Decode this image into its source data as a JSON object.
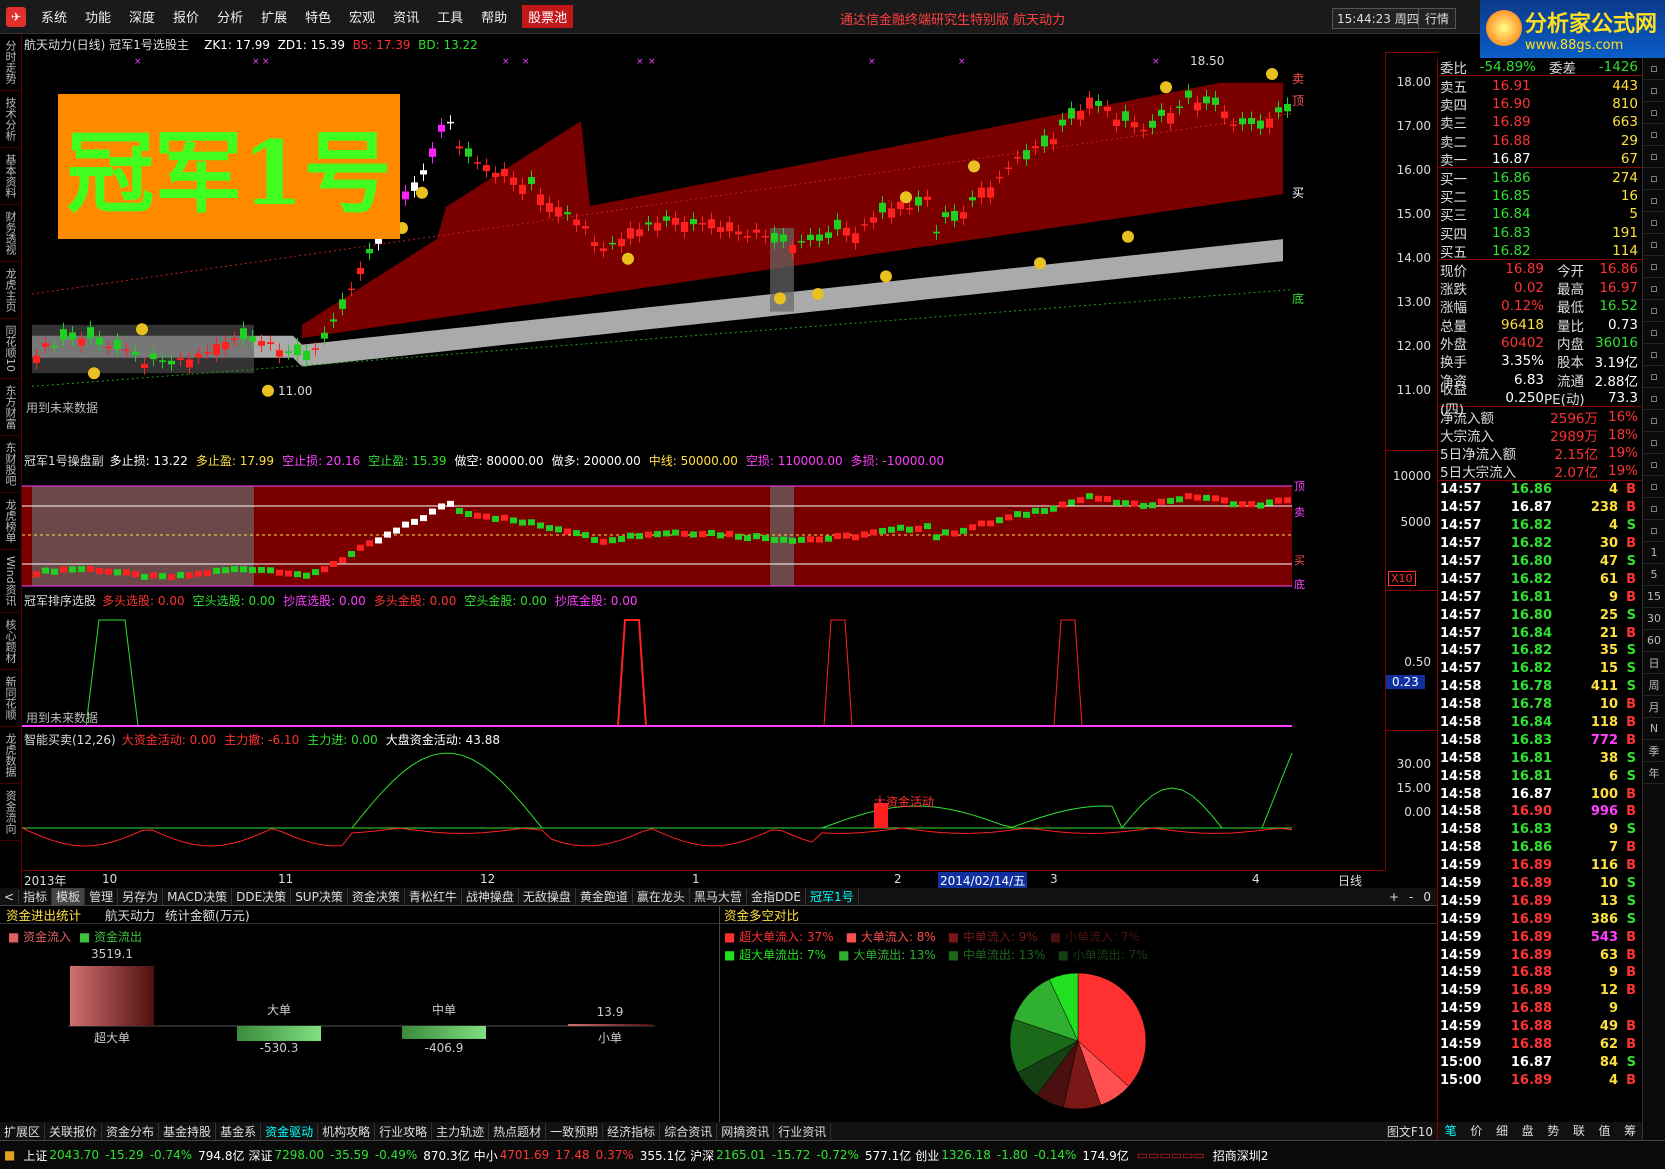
{
  "menu": {
    "items": [
      "系统",
      "功能",
      "深度",
      "报价",
      "分析",
      "扩展",
      "特色",
      "宏观",
      "资讯",
      "工具",
      "帮助"
    ],
    "stock_pool": "股票池",
    "window_title": "通达信金融终端研究生特别版  航天动力",
    "clock": "15:44:23",
    "clock_suffix": "周四",
    "hq_button": "行情",
    "brand_line1": "分析家公式网",
    "brand_line2": "www.88gs.com"
  },
  "left_tabs": [
    "分时走势",
    "技术分析",
    "基本资料",
    "财务透视",
    "龙虎主页",
    "同花顺10",
    "东方财富"
  ],
  "left_tabs_lower": [
    "东财股吧",
    "龙虎榜单",
    "Wind资讯",
    "核心题材",
    "新同花顺",
    "龙虎数据",
    "资金流向"
  ],
  "main_chart": {
    "title": "航天动力(日线) 冠军1号选股主",
    "zk1": "ZK1: 17.99",
    "zd1": "ZD1: 15.39",
    "bs": "BS: 17.39",
    "bd": "BD: 13.22",
    "banner": "冠军1号",
    "high_label": "18.50",
    "low_label": "11.00",
    "future_note": "用到未来数据",
    "side_labels": [
      "卖",
      "顶",
      "买",
      "底"
    ],
    "y_ticks": [
      "18.00",
      "17.00",
      "16.00",
      "15.00",
      "14.00",
      "13.00",
      "12.00",
      "11.00"
    ],
    "colors": {
      "band": "#7a0000",
      "grey_band": "#c8c8c8"
    }
  },
  "panel2": {
    "title": "冠军1号操盘副",
    "items": [
      {
        "label": "多止损: 13.22",
        "color": "#ffffff"
      },
      {
        "label": "多止盈: 17.99",
        "color": "#ffe040"
      },
      {
        "label": "空止损: 20.16",
        "color": "#ff40ff"
      },
      {
        "label": "空止盈: 15.39",
        "color": "#30e030"
      },
      {
        "label": "做空: 80000.00",
        "color": "#ffffff"
      },
      {
        "label": "做多: 20000.00",
        "color": "#ffffff"
      },
      {
        "label": "中线: 50000.00",
        "color": "#ffe040"
      },
      {
        "label": "空损: 110000.00",
        "color": "#ff40ff"
      },
      {
        "label": "多损: -10000.00",
        "color": "#ff40ff"
      }
    ],
    "y_ticks": [
      "10000",
      "5000"
    ],
    "x10": "X10",
    "side_labels": [
      "顶",
      "卖",
      "买",
      "底"
    ]
  },
  "panel3": {
    "title": "冠军排序选股",
    "items": [
      {
        "label": "多头选股: 0.00",
        "color": "#ff3333"
      },
      {
        "label": "空头选股: 0.00",
        "color": "#30e030"
      },
      {
        "label": "抄底选股: 0.00",
        "color": "#ff40ff"
      },
      {
        "label": "多头金股: 0.00",
        "color": "#ff3333"
      },
      {
        "label": "空头金股: 0.00",
        "color": "#30e030"
      },
      {
        "label": "抄底金股: 0.00",
        "color": "#ff40ff"
      }
    ],
    "y_tick": "0.50",
    "value_box": "0.23",
    "future_note": "用到未来数据"
  },
  "panel4": {
    "title": "智能买卖(12,26)",
    "items": [
      {
        "label": "大资金活动: 0.00",
        "color": "#ff3333"
      },
      {
        "label": "主力撤: -6.10",
        "color": "#ff3333"
      },
      {
        "label": "主力进: 0.00",
        "color": "#30e030"
      },
      {
        "label": "大盘资金活动: 43.88",
        "color": "#ffffff"
      }
    ],
    "annotation": "大资金活动",
    "y_ticks": [
      "30.00",
      "15.00",
      "0.00"
    ]
  },
  "xaxis": {
    "labels": [
      "2013年",
      "10",
      "11",
      "12",
      "1",
      "2",
      "2014/02/14/五",
      "3",
      "4"
    ],
    "period": "日线"
  },
  "tabs_row1": [
    "指标",
    "模板",
    "管理",
    "另存为",
    "MACD决策",
    "DDE决策",
    "SUP决策",
    "资金决策",
    "青松红牛",
    "战神操盘",
    "无敌操盘",
    "黄金跑道",
    "赢在龙头",
    "黑马大营",
    "金指DDE",
    "冠军1号"
  ],
  "tabs_row1_right": [
    "+",
    "-",
    "0"
  ],
  "capital": {
    "title": "资金进出统计",
    "stock": "航天动力",
    "unit": "统计金额(万元)",
    "legend_in": "资金流入",
    "legend_out": "资金流出",
    "bars": [
      {
        "name": "超大单",
        "value": "3519.1"
      },
      {
        "name": "大单",
        "value": "-530.3"
      },
      {
        "name": "中单",
        "value": "-406.9"
      },
      {
        "name": "小单",
        "value": "13.9"
      }
    ]
  },
  "compare": {
    "title": "资金多空对比",
    "row_in": [
      {
        "label": "超大单流入: 37%",
        "color": "#ff3030"
      },
      {
        "label": "大单流入:  8%",
        "color": "#ff5050"
      },
      {
        "label": "中单流入:  9%",
        "color": "#7a1818"
      },
      {
        "label": "小单流入:  7%",
        "color": "#4a1010"
      }
    ],
    "row_out": [
      {
        "label": "超大单流出:  7%",
        "color": "#20e020"
      },
      {
        "label": "大单流出: 13%",
        "color": "#30b030"
      },
      {
        "label": "中单流出: 13%",
        "color": "#1a6a1a"
      },
      {
        "label": "小单流出:  7%",
        "color": "#144014"
      }
    ],
    "pie": [
      37,
      8,
      9,
      7,
      7,
      13,
      13,
      7
    ]
  },
  "tabs_row2": [
    "扩展区",
    "关联报价",
    "资金分布",
    "基金持股",
    "基金系",
    "资金驱动",
    "机构攻略",
    "行业攻略",
    "主力轨迹",
    "热点题材",
    "一致预期",
    "经济指标",
    "综合资讯",
    "网摘资讯",
    "行业资讯"
  ],
  "tabs_row2_right": "图文F10",
  "quote": {
    "weibi_label": "委比",
    "weibi": "-54.89%",
    "weicha_label": "委差",
    "weicha": "-1426",
    "sell": [
      {
        "label": "卖五",
        "price": "16.91",
        "vol": "443"
      },
      {
        "label": "卖四",
        "price": "16.90",
        "vol": "810"
      },
      {
        "label": "卖三",
        "price": "16.89",
        "vol": "663"
      },
      {
        "label": "卖二",
        "price": "16.88",
        "vol": "29"
      },
      {
        "label": "卖一",
        "price": "16.87",
        "vol": "67"
      }
    ],
    "buy": [
      {
        "label": "买一",
        "price": "16.86",
        "vol": "274"
      },
      {
        "label": "买二",
        "price": "16.85",
        "vol": "16"
      },
      {
        "label": "买三",
        "price": "16.84",
        "vol": "5"
      },
      {
        "label": "买四",
        "price": "16.83",
        "vol": "191"
      },
      {
        "label": "买五",
        "price": "16.82",
        "vol": "114"
      }
    ],
    "stats": [
      {
        "l1": "现价",
        "v1": "16.89",
        "l2": "今开",
        "v2": "16.86"
      },
      {
        "l1": "涨跌",
        "v1": "0.02",
        "l2": "最高",
        "v2": "16.97"
      },
      {
        "l1": "涨幅",
        "v1": "0.12%",
        "l2": "最低",
        "v2": "16.52"
      },
      {
        "l1": "总量",
        "v1": "96418",
        "l2": "量比",
        "v2": "0.73"
      },
      {
        "l1": "外盘",
        "v1": "60402",
        "l2": "内盘",
        "v2": "36016"
      },
      {
        "l1": "换手",
        "v1": "3.35%",
        "l2": "股本",
        "v2": "3.19亿"
      },
      {
        "l1": "净资",
        "v1": "6.83",
        "l2": "流通",
        "v2": "2.88亿"
      },
      {
        "l1": "收益(四)",
        "v1": "0.250",
        "l2": "PE(动)",
        "v2": "73.3"
      }
    ],
    "flows": [
      {
        "label": "净流入额",
        "value": "2596万",
        "pct": "16%"
      },
      {
        "label": "大宗流入",
        "value": "2989万",
        "pct": "18%"
      },
      {
        "label": "5日净流入额",
        "value": "2.15亿",
        "pct": "19%"
      },
      {
        "label": "5日大宗流入",
        "value": "2.07亿",
        "pct": "19%"
      }
    ]
  },
  "ticks": [
    {
      "t": "14:57",
      "p": "16.86",
      "v": "4",
      "d": "B"
    },
    {
      "t": "14:57",
      "p": "16.87",
      "v": "238",
      "d": "B"
    },
    {
      "t": "14:57",
      "p": "16.82",
      "v": "4",
      "d": "S"
    },
    {
      "t": "14:57",
      "p": "16.82",
      "v": "30",
      "d": "B"
    },
    {
      "t": "14:57",
      "p": "16.80",
      "v": "47",
      "d": "S"
    },
    {
      "t": "14:57",
      "p": "16.82",
      "v": "61",
      "d": "B"
    },
    {
      "t": "14:57",
      "p": "16.81",
      "v": "9",
      "d": "B"
    },
    {
      "t": "14:57",
      "p": "16.80",
      "v": "25",
      "d": "S"
    },
    {
      "t": "14:57",
      "p": "16.84",
      "v": "21",
      "d": "B"
    },
    {
      "t": "14:57",
      "p": "16.82",
      "v": "35",
      "d": "S"
    },
    {
      "t": "14:57",
      "p": "16.82",
      "v": "15",
      "d": "S"
    },
    {
      "t": "14:58",
      "p": "16.78",
      "v": "411",
      "d": "S"
    },
    {
      "t": "14:58",
      "p": "16.78",
      "v": "10",
      "d": "B"
    },
    {
      "t": "14:58",
      "p": "16.84",
      "v": "118",
      "d": "B"
    },
    {
      "t": "14:58",
      "p": "16.83",
      "v": "772",
      "d": "B"
    },
    {
      "t": "14:58",
      "p": "16.81",
      "v": "38",
      "d": "S"
    },
    {
      "t": "14:58",
      "p": "16.81",
      "v": "6",
      "d": "S"
    },
    {
      "t": "14:58",
      "p": "16.87",
      "v": "100",
      "d": "B"
    },
    {
      "t": "14:58",
      "p": "16.90",
      "v": "996",
      "d": "B"
    },
    {
      "t": "14:58",
      "p": "16.83",
      "v": "9",
      "d": "S"
    },
    {
      "t": "14:58",
      "p": "16.86",
      "v": "7",
      "d": "B"
    },
    {
      "t": "14:59",
      "p": "16.89",
      "v": "116",
      "d": "B"
    },
    {
      "t": "14:59",
      "p": "16.89",
      "v": "10",
      "d": "S"
    },
    {
      "t": "14:59",
      "p": "16.89",
      "v": "13",
      "d": "S"
    },
    {
      "t": "14:59",
      "p": "16.89",
      "v": "386",
      "d": "S"
    },
    {
      "t": "14:59",
      "p": "16.89",
      "v": "543",
      "d": "B"
    },
    {
      "t": "14:59",
      "p": "16.89",
      "v": "63",
      "d": "B"
    },
    {
      "t": "14:59",
      "p": "16.88",
      "v": "9",
      "d": "B"
    },
    {
      "t": "14:59",
      "p": "16.89",
      "v": "12",
      "d": "B"
    },
    {
      "t": "14:59",
      "p": "16.88",
      "v": "9",
      "d": ""
    },
    {
      "t": "14:59",
      "p": "16.88",
      "v": "49",
      "d": "B"
    },
    {
      "t": "14:59",
      "p": "16.88",
      "v": "62",
      "d": "B"
    },
    {
      "t": "15:00",
      "p": "16.87",
      "v": "84",
      "d": "S"
    },
    {
      "t": "15:00",
      "p": "16.89",
      "v": "4",
      "d": "B"
    }
  ],
  "right_bottom_tabs": [
    "笔",
    "价",
    "细",
    "盘",
    "势",
    "联",
    "值",
    "筹"
  ],
  "side_buttons": [
    "1",
    "5",
    "15",
    "30",
    "60",
    "日",
    "周",
    "月",
    "N",
    "季",
    "年"
  ],
  "status": {
    "indices": [
      {
        "name": "上证",
        "value": "2043.70",
        "chg": "-15.29",
        "pct": "-0.74%",
        "amt": "794.8亿"
      },
      {
        "name": "深证",
        "value": "7298.00",
        "chg": "-35.59",
        "pct": "-0.49%",
        "amt": "870.3亿"
      },
      {
        "name": "中小",
        "value": "4701.69",
        "chg": "17.48",
        "pct": "0.37%",
        "amt": "355.1亿"
      },
      {
        "name": "沪深",
        "value": "2165.01",
        "chg": "-15.72",
        "pct": "-0.72%",
        "amt": "577.1亿"
      },
      {
        "name": "创业",
        "value": "1326.18",
        "chg": "-1.80",
        "pct": "-0.14%",
        "amt": "174.9亿"
      }
    ],
    "broker": "招商深圳2"
  }
}
